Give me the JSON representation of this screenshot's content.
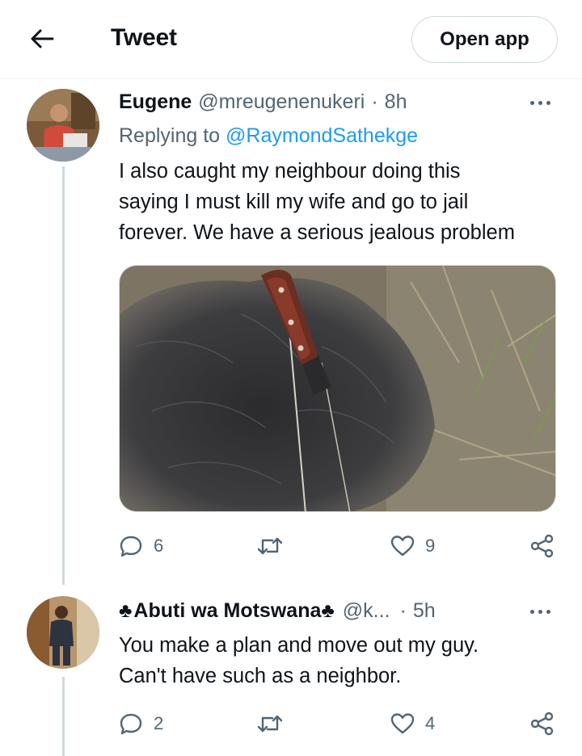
{
  "header": {
    "title": "Tweet",
    "open_app_label": "Open app",
    "back_icon": "arrow-left-icon"
  },
  "tweets": [
    {
      "display_name": "Eugene",
      "handle": "@mreugenenukeri",
      "separator": "·",
      "time": "8h",
      "replying_prefix": "Replying to ",
      "replying_to": "@RaymondSathekge",
      "lines": [
        "I also caught my neighbour doing this",
        "saying I must kill my wife and go to jail",
        "forever. We have a serious jealous problem"
      ],
      "media": "photo of a knife stuck in black feathers on dry grass",
      "replies": "6",
      "retweets": "",
      "likes": "9"
    },
    {
      "name_prefix_icon": "♣",
      "display_name": "Abuti wa Motswana",
      "name_suffix_icon": "♣",
      "handle": "@k...",
      "separator": "·",
      "time": "5h",
      "lines": [
        "You make a plan and move out my guy.",
        "Can't have such as a neighbor."
      ],
      "replies": "2",
      "retweets": "",
      "likes": "4"
    }
  ],
  "colors": {
    "accent": "#1d9bf0",
    "secondary_text": "#536471",
    "primary_text": "#0f1419",
    "divider": "#cfd9de"
  }
}
